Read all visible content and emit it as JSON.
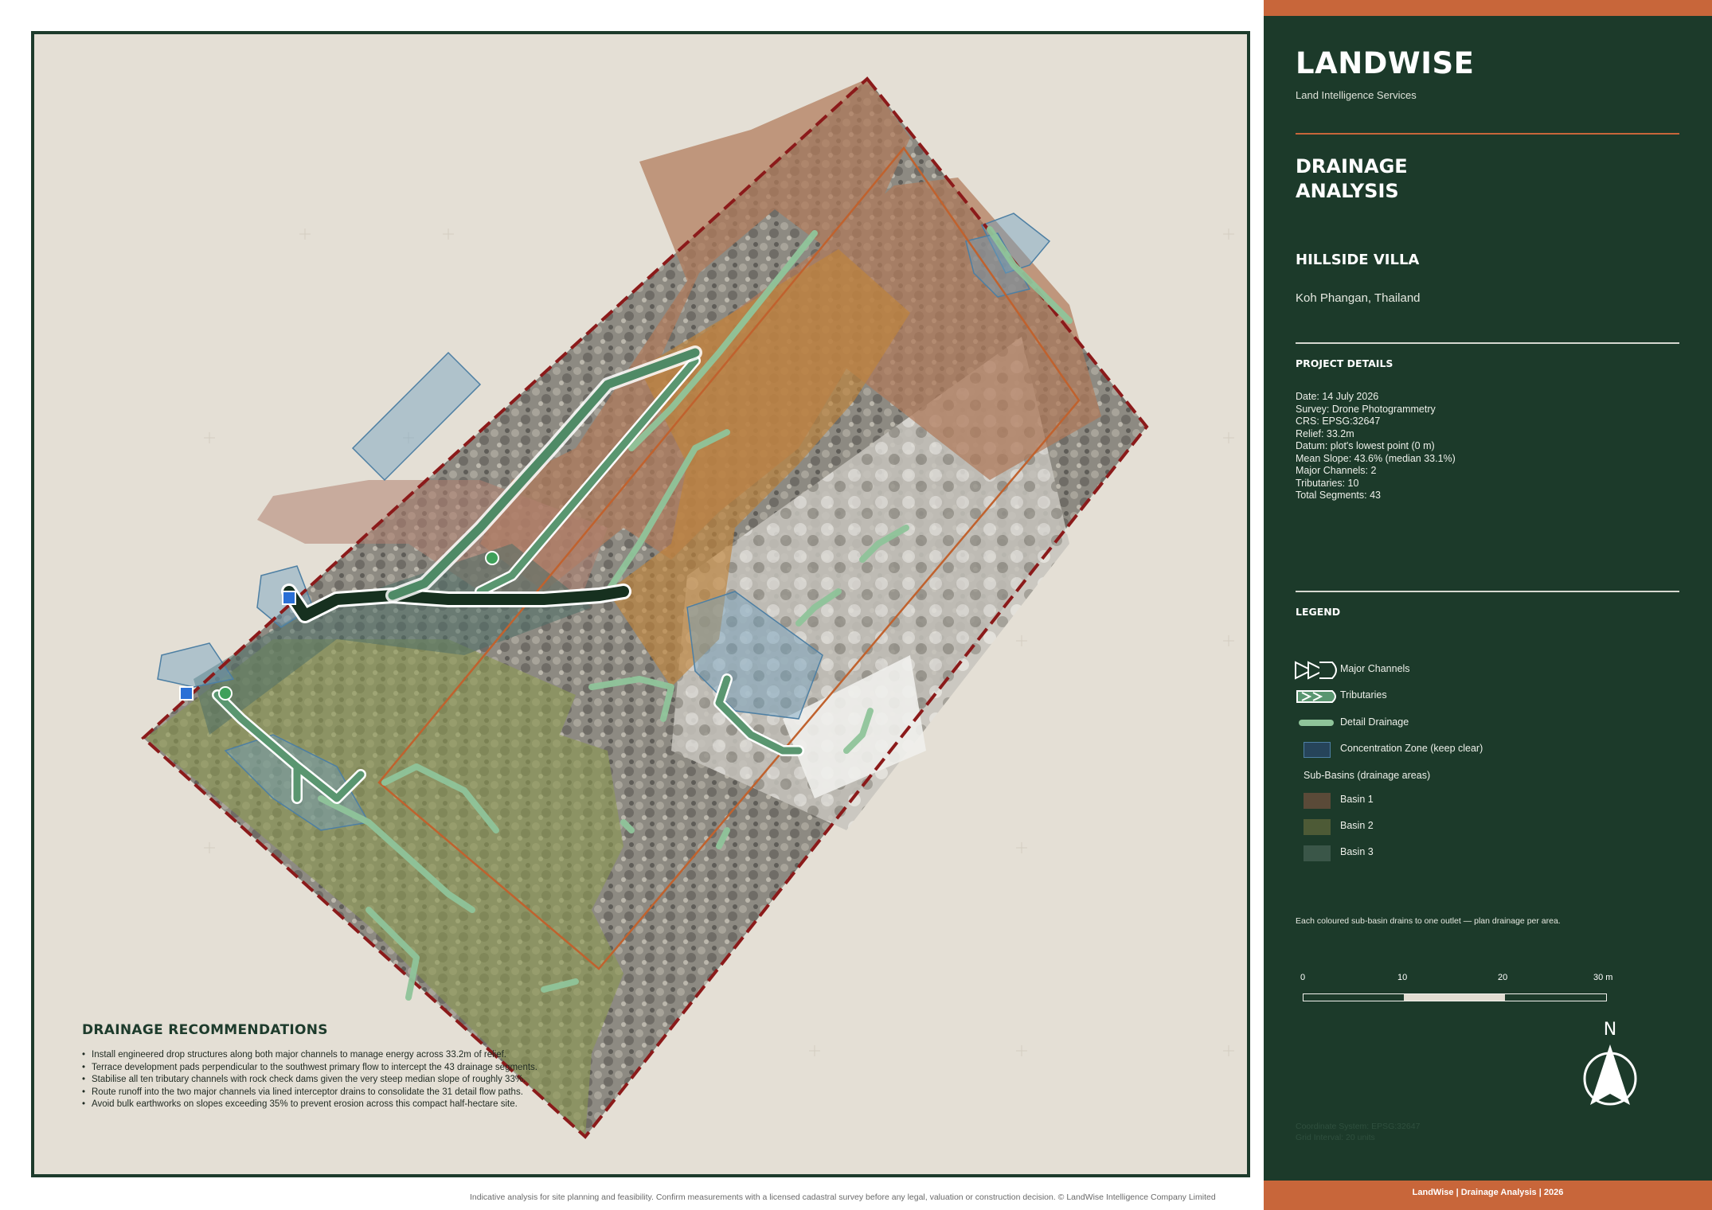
{
  "map": {
    "recommendations": {
      "title": "DRAINAGE RECOMMENDATIONS",
      "items": [
        "Install engineered drop structures along both major channels to manage energy across 33.2m of relief.",
        "Terrace development pads perpendicular to the southwest primary flow to intercept the 43 drainage segments.",
        "Stabilise all ten tributary channels with rock check dams given the very steep median slope of roughly 33%.",
        "Route runoff into the two major channels via lined interceptor drains to consolidate the 31 detail flow paths.",
        "Avoid bulk earthworks on slopes exceeding 35% to prevent erosion across this compact half-hectare site."
      ]
    },
    "footer_note": "Indicative analysis for site planning and feasibility. Confirm measurements with a licensed cadastral survey before any legal, valuation or construction decision. © LandWise Intelligence Company Limited",
    "colors": {
      "background": "#e4dfd5",
      "site_boundary": "#8b1a1a",
      "building_envelope": "#c0622e",
      "basin_1": "#b07a5a",
      "basin_2": "#8c9a50",
      "basin_3": "#4f6f68",
      "concentration_zone": "#6f9fbf",
      "detail_drainage": "#8fc49a",
      "major_channel": "#1d3b2c",
      "outlet": "#2a6fd6",
      "source": "#3fa05a"
    }
  },
  "sidebar": {
    "brand": "LANDWISE",
    "brand_sub": "Land Intelligence Services",
    "report_title": "DRAINAGE\nANALYSIS",
    "project_name": "HILLSIDE VILLA",
    "location": "Koh Phangan, Thailand",
    "details_heading": "PROJECT DETAILS",
    "details": [
      "Date:  14 July 2026",
      "Survey:  Drone Photogrammetry",
      "CRS:  EPSG:32647",
      "Relief:  33.2m",
      "Datum:  plot's lowest point (0 m)",
      "Mean Slope:  43.6%  (median 33.1%)",
      "Major Channels:  2",
      "Tributaries:  10",
      "Total Segments:  43"
    ],
    "legend": {
      "heading": "LEGEND",
      "major_channels": "Major Channels",
      "tributaries": "Tributaries",
      "detail_drainage": "Detail Drainage",
      "concentration_zone": "Concentration Zone (keep clear)",
      "subbasins_heading": "Sub-Basins (drainage areas)",
      "basin_1": "Basin 1",
      "basin_2": "Basin 2",
      "basin_3": "Basin 3",
      "basin_1_color": "#5a4a38",
      "basin_2_color": "#4d5a36",
      "basin_3_color": "#3a5648",
      "zone_color": "#26445a"
    },
    "basin_note": "Each coloured sub-basin drains to one outlet — plan drainage per area.",
    "scale": {
      "ticks": [
        "0",
        "10",
        "20",
        "30 m"
      ]
    },
    "north_label": "N",
    "crs_note": [
      "Coordinate System: EPSG:32647",
      "Grid Interval: 20 units"
    ],
    "footer": "LandWise  |  Drainage Analysis  |  2026"
  }
}
